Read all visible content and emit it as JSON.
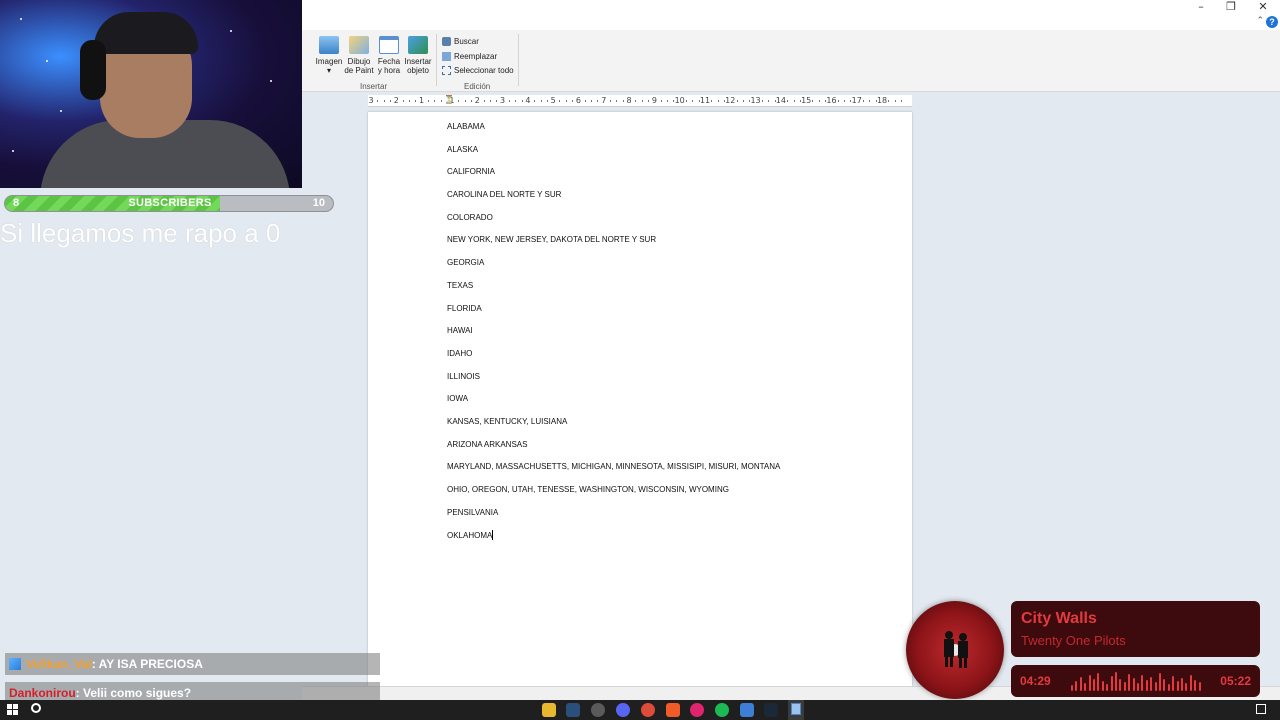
{
  "ribbon": {
    "insert_buttons": [
      {
        "label": "Imagen",
        "icon": "image-icon"
      },
      {
        "label": "Dibujo\nde Paint",
        "icon": "paint-drawing-icon"
      },
      {
        "label": "Fecha\ny hora",
        "icon": "calendar-icon"
      },
      {
        "label": "Insertar\nobjeto",
        "icon": "object-icon"
      }
    ],
    "insert_group_label": "Insertar",
    "edit_items": [
      {
        "label": "Buscar",
        "icon": "binoculars-icon"
      },
      {
        "label": "Reemplazar",
        "icon": "replace-icon"
      },
      {
        "label": "Seleccionar todo",
        "icon": "select-all-icon"
      }
    ],
    "edit_group_label": "Edición"
  },
  "ruler": {
    "ticks": [
      "3",
      "2",
      "1",
      "1",
      "2",
      "3",
      "4",
      "5",
      "6",
      "7",
      "8",
      "9",
      "10",
      "11",
      "12",
      "13",
      "14",
      "15",
      "16",
      "17",
      "18"
    ]
  },
  "document": {
    "lines": [
      " ALABAMA",
      "ALASKA",
      "CALIFORNIA",
      "CAROLINA DEL NORTE Y SUR",
      "COLORADO",
      "NEW YORK, NEW JERSEY, DAKOTA DEL NORTE Y SUR",
      "GEORGIA",
      "TEXAS",
      "FLORIDA",
      "HAWAI",
      "IDAHO",
      "ILLINOIS",
      "IOWA",
      "KANSAS, KENTUCKY, LUISIANA",
      "ARIZONA ARKANSAS",
      "MARYLAND, MASSACHUSETTS, MICHIGAN, MINNESOTA, MISSISIPI, MISURI, MONTANA",
      "OHIO, OREGON, UTAH, TENESSE, WASHINGTON, WISCONSIN, WYOMING",
      "PENSILVANIA",
      "OKLAHOMA"
    ]
  },
  "stream": {
    "sub_goal": {
      "current": "8",
      "title": "SUBSCRIBERS",
      "target": "10",
      "progress_fraction": 0.8
    },
    "goal_message": "Si llegamos me rapo a 0",
    "chat": [
      {
        "user": "Velikan_Val",
        "sep": ":",
        "message": " AY ISA PRECIOSA"
      },
      {
        "user": "Dankonirou",
        "sep": ":",
        "message": " Velii como sigues?"
      }
    ],
    "now_playing": {
      "title": "City Walls",
      "artist": "Twenty One Pilots",
      "elapsed": "04:29",
      "duration": "05:22"
    }
  },
  "colors": {
    "accent_red": "#e23a3f",
    "music_card_bg": "#3d0a0d",
    "sub_bar_green": "#5cc445"
  }
}
